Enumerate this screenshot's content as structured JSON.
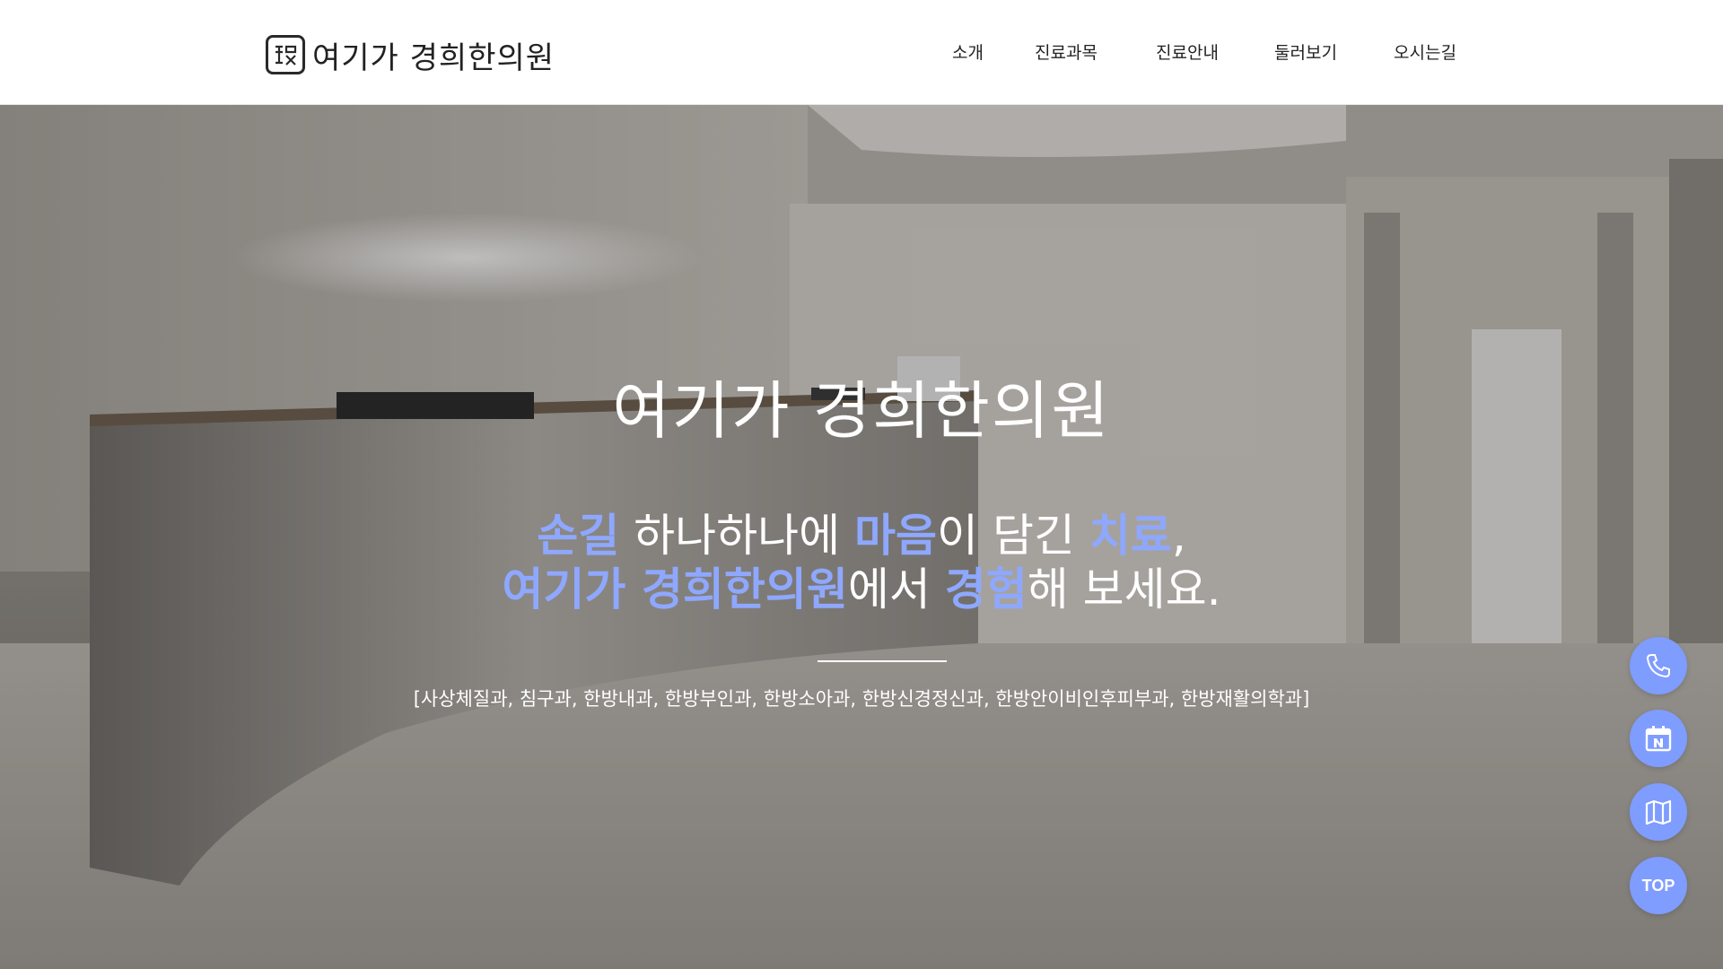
{
  "header": {
    "logo_text": "여기가 경희한의원",
    "nav": [
      {
        "label": "소개"
      },
      {
        "label": "진료과목"
      },
      {
        "label": "진료안내"
      },
      {
        "label": "둘러보기"
      },
      {
        "label": "오시는길"
      }
    ]
  },
  "hero": {
    "title": "여기가 경희한의원",
    "line1": {
      "part1": "손길",
      "part2": " 하나하나에 ",
      "part3": "마음",
      "part4": "이 담긴 ",
      "part5": "치료",
      "part6": ","
    },
    "line2": {
      "part1": "여기가 경희한의원",
      "part2": "에서 ",
      "part3": "경험",
      "part4": "해 보세요."
    },
    "departments": "[사상체질과, 침구과, 한방내과, 한방부인과, 한방소아과, 한방신경정신과, 한방안이비인후피부과, 한방재활의학과]"
  },
  "floating": {
    "top_label": "TOP",
    "accent_color": "#7f9cff",
    "icons": [
      "phone-icon",
      "naver-calendar-icon",
      "map-icon"
    ]
  }
}
